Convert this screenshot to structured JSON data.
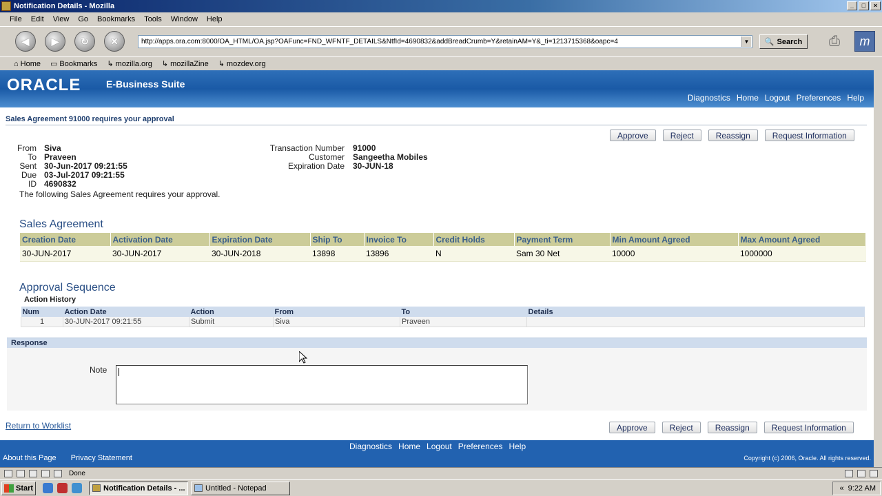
{
  "window": {
    "title": "Notification Details - Mozilla"
  },
  "menu": [
    "File",
    "Edit",
    "View",
    "Go",
    "Bookmarks",
    "Tools",
    "Window",
    "Help"
  ],
  "nav": {
    "url": "http://apps.ora.com:8000/OA_HTML/OA.jsp?OAFunc=FND_WFNTF_DETAILS&NtfId=4690832&addBreadCrumb=Y&retainAM=Y&_ti=1213715368&oapc=4",
    "search_label": "Search"
  },
  "personal_bar": [
    "Home",
    "Bookmarks",
    "mozilla.org",
    "mozillaZine",
    "mozdev.org"
  ],
  "oracle": {
    "logo": "ORACLE",
    "suite": "E-Business Suite",
    "global_links": [
      "Diagnostics",
      "Home",
      "Logout",
      "Preferences",
      "Help"
    ]
  },
  "page": {
    "title": "Sales Agreement 91000 requires your approval",
    "buttons": [
      "Approve",
      "Reject",
      "Reassign",
      "Request Information"
    ],
    "header_left": [
      {
        "label": "From",
        "value": "Siva"
      },
      {
        "label": "To",
        "value": "Praveen"
      },
      {
        "label": "Sent",
        "value": "30-Jun-2017 09:21:55"
      },
      {
        "label": "Due",
        "value": "03-Jul-2017 09:21:55"
      },
      {
        "label": "ID",
        "value": "4690832"
      }
    ],
    "header_right": [
      {
        "label": "Transaction Number",
        "value": "91000"
      },
      {
        "label": "Customer",
        "value": "Sangeetha Mobiles"
      },
      {
        "label": "Expiration Date",
        "value": "30-JUN-18"
      }
    ],
    "message": "The following Sales Agreement requires your approval."
  },
  "sales_agreement": {
    "title": "Sales Agreement",
    "columns": [
      "Creation Date",
      "Activation Date",
      "Expiration Date",
      "Ship To",
      "Invoice To",
      "Credit Holds",
      "Payment Term",
      "Min Amount Agreed",
      "Max Amount Agreed"
    ],
    "row": [
      "30-JUN-2017",
      "30-JUN-2017",
      "30-JUN-2018",
      "13898",
      "13896",
      "N",
      "Sam 30 Net",
      "10000",
      "1000000"
    ]
  },
  "approval": {
    "title": "Approval Sequence",
    "subtitle": "Action History",
    "columns": [
      "Num",
      "Action Date",
      "Action",
      "From",
      "To",
      "Details"
    ],
    "row": [
      "1",
      "30-JUN-2017 09:21:55",
      "Submit",
      "Siva",
      "Praveen",
      ""
    ]
  },
  "response": {
    "title": "Response",
    "note_label": "Note"
  },
  "return_link": "Return to Worklist",
  "footer": {
    "links": [
      "Diagnostics",
      "Home",
      "Logout",
      "Preferences",
      "Help"
    ],
    "about": "About this Page",
    "privacy": "Privacy Statement",
    "copyright": "Copyright (c) 2006, Oracle. All rights reserved."
  },
  "status": {
    "text": "Done"
  },
  "taskbar": {
    "start": "Start",
    "tasks": [
      "Notification Details - ...",
      "Untitled - Notepad"
    ],
    "clock": "9:22 AM"
  }
}
